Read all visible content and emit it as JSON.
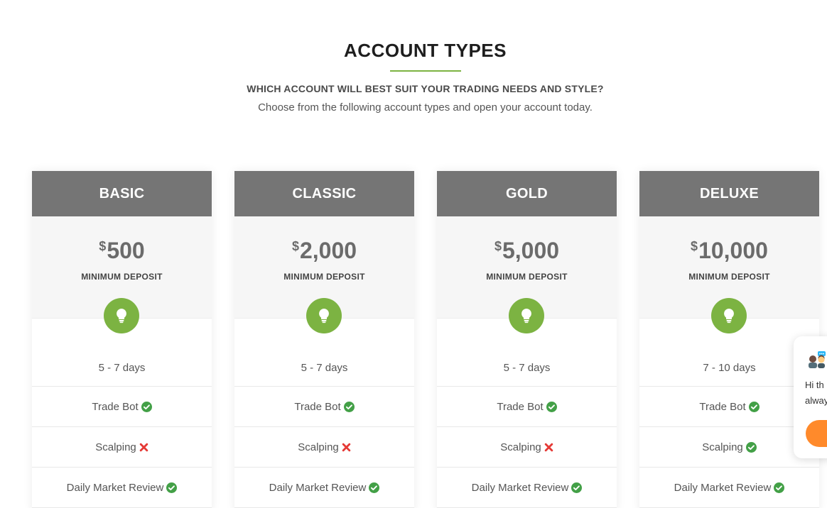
{
  "header": {
    "title": "ACCOUNT TYPES",
    "subtitle": "WHICH ACCOUNT WILL BEST SUIT YOUR TRADING NEEDS AND STYLE?",
    "description": "Choose from the following account types and open your account today."
  },
  "colors": {
    "accent": "#7cb342",
    "header_bg": "#757575",
    "check": "#43a047",
    "cross": "#e53935",
    "chat_button": "#ff8a2b"
  },
  "plans": [
    {
      "name": "BASIC",
      "currency": "$",
      "amount": "500",
      "deposit_label": "MINIMUM DEPOSIT",
      "icon": "lightbulb-icon",
      "duration": "5 - 7 days",
      "features": [
        {
          "label": "Trade Bot",
          "included": true,
          "icon": "check-circle-icon"
        },
        {
          "label": "Scalping",
          "included": false,
          "icon": "cross-icon"
        },
        {
          "label": "Daily Market Review",
          "included": true,
          "icon": "check-circle-icon"
        }
      ]
    },
    {
      "name": "CLASSIC",
      "currency": "$",
      "amount": "2,000",
      "deposit_label": "MINIMUM DEPOSIT",
      "icon": "lightbulb-icon",
      "duration": "5 - 7 days",
      "features": [
        {
          "label": "Trade Bot",
          "included": true,
          "icon": "check-circle-icon"
        },
        {
          "label": "Scalping",
          "included": false,
          "icon": "cross-icon"
        },
        {
          "label": "Daily Market Review",
          "included": true,
          "icon": "check-circle-icon"
        }
      ]
    },
    {
      "name": "GOLD",
      "currency": "$",
      "amount": "5,000",
      "deposit_label": "MINIMUM DEPOSIT",
      "icon": "lightbulb-icon",
      "duration": "5 - 7 days",
      "features": [
        {
          "label": "Trade Bot",
          "included": true,
          "icon": "check-circle-icon"
        },
        {
          "label": "Scalping",
          "included": false,
          "icon": "cross-icon"
        },
        {
          "label": "Daily Market Review",
          "included": true,
          "icon": "check-circle-icon"
        }
      ]
    },
    {
      "name": "DELUXE",
      "currency": "$",
      "amount": "10,000",
      "deposit_label": "MINIMUM DEPOSIT",
      "icon": "lightbulb-icon",
      "duration": "7 - 10 days",
      "features": [
        {
          "label": "Trade Bot",
          "included": true,
          "icon": "check-circle-icon"
        },
        {
          "label": "Scalping",
          "included": true,
          "icon": "check-circle-icon"
        },
        {
          "label": "Daily Market Review",
          "included": true,
          "icon": "check-circle-icon"
        }
      ]
    }
  ],
  "chat": {
    "line1": "Hi th",
    "line2": "alway",
    "avatar_icon": "support-agent-icon"
  }
}
